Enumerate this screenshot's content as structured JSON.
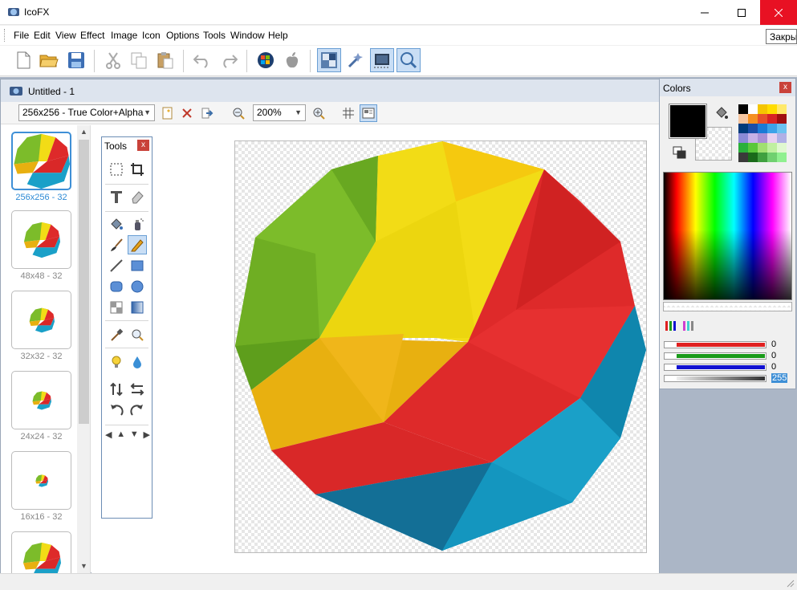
{
  "window": {
    "title": "IcoFX",
    "tooltip": "Закрыть"
  },
  "menu": [
    "File",
    "Edit",
    "View",
    "Effect",
    "Image",
    "Icon",
    "Options",
    "Tools",
    "Window",
    "Help"
  ],
  "toolbar": {
    "icons": [
      "new-file-icon",
      "open-folder-icon",
      "save-icon",
      "cut-icon",
      "copy-icon",
      "paste-icon",
      "undo-icon",
      "redo-icon",
      "windows-logo-icon",
      "apple-logo-icon",
      "image-editor-icon",
      "wand-icon",
      "screen-capture-icon",
      "zoom-tool-icon"
    ]
  },
  "document": {
    "title": "Untitled - 1",
    "format_select": "256x256 - True Color+Alpha",
    "zoom_select": "200%"
  },
  "formats": [
    {
      "label": "256x256 - 32",
      "size": 72,
      "selected": true
    },
    {
      "label": "48x48 - 32",
      "size": 46,
      "selected": false
    },
    {
      "label": "32x32 - 32",
      "size": 32,
      "selected": false
    },
    {
      "label": "24x24 - 32",
      "size": 24,
      "selected": false
    },
    {
      "label": "16x16 - 32",
      "size": 16,
      "selected": false
    },
    {
      "label": "",
      "size": 48,
      "selected": false
    }
  ],
  "tools_panel": {
    "title": "Tools",
    "close": "x"
  },
  "colors_panel": {
    "title": "Colors",
    "close": "x",
    "foreground": "#000000",
    "red": "0",
    "green": "0",
    "blue": "0",
    "alpha": "255"
  },
  "colors": {
    "red": "#e02020",
    "green": "#1a9a1a",
    "blue": "#1010d0",
    "gray": "#888888",
    "accent": "#3e8fd6"
  }
}
